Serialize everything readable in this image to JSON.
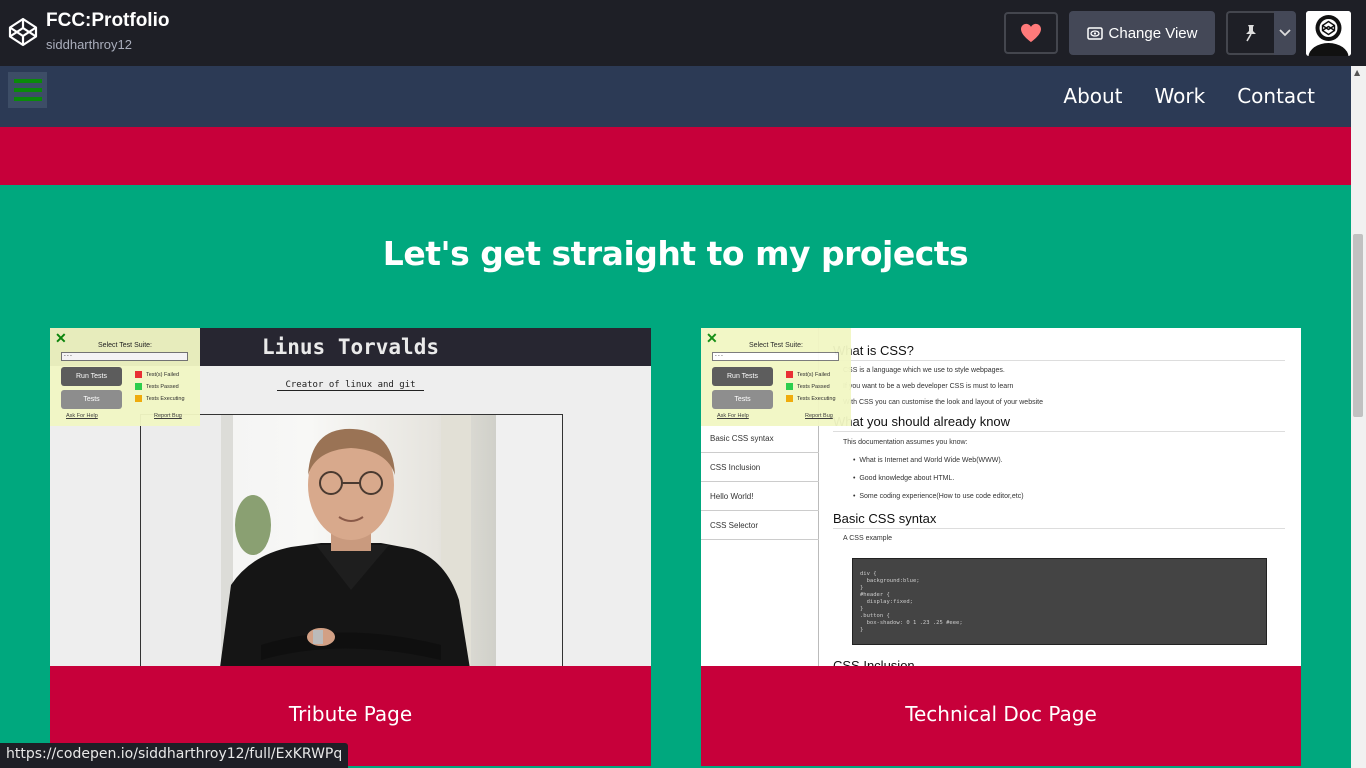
{
  "codepen_header": {
    "title": "FCC:Protfolio",
    "username": "siddharthroy12",
    "change_view_label": "Change View"
  },
  "nav": {
    "links": [
      "About",
      "Work",
      "Contact"
    ]
  },
  "projects": {
    "heading": "Let's get straight to my projects",
    "cards": [
      {
        "label": "Tribute Page"
      },
      {
        "label": "Technical Doc Page"
      }
    ]
  },
  "tribute_thumb": {
    "title": "Linus Torvalds",
    "subtitle": "Creator of linux and git"
  },
  "test_panel": {
    "close": "✕",
    "select_label": "Select Test Suite:",
    "select_value": "- - -",
    "run_button": "Run Tests",
    "tests_button": "Tests",
    "legend": [
      "Test(s) Failed",
      "Tests Passed",
      "Tests Executing"
    ],
    "ask_help": "Ask For Help",
    "report_bug": "Report Bug",
    "legend_colors": [
      "#e8262a",
      "#22cc44",
      "#f0a800"
    ]
  },
  "doc_thumb": {
    "sidebar": [
      "Basic CSS syntax",
      "CSS Inclusion",
      "Hello World!",
      "CSS Selector"
    ],
    "h1": "What is CSS?",
    "p1": "CSS is a language which we use to style webpages.",
    "p2": "If you want to be a web developer CSS is must to learn",
    "p3": "With CSS you can customise the look and layout of your website",
    "h2": "What you should already know",
    "p4": "This documentation assumes you know:",
    "li1": "What is Internet and World Wide Web(WWW).",
    "li2": "Good knowledge about HTML.",
    "li3": "Some coding experience(How to use code editor,etc)",
    "h3": "Basic CSS syntax",
    "p5": "A CSS example",
    "code": "div {\n  background:blue;\n}\n#header {\n  display:fixed;\n}\n.button {\n  box-shadow: 0 1 .23 .25 #eee;\n}",
    "h4": "CSS Inclusion"
  },
  "status_url": "https://codepen.io/siddharthroy12/full/ExKRWPq"
}
